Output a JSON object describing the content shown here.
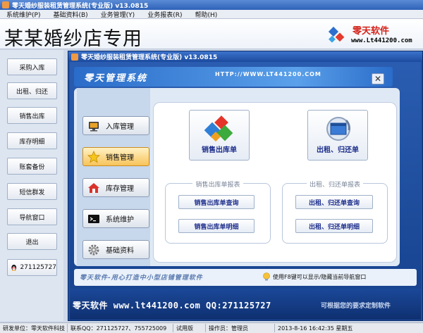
{
  "window": {
    "title": "零天婚纱服装租赁管理系统(专业版)  v13.0815"
  },
  "menu": [
    "系统维护(P)",
    "基础资料(B)",
    "业务管理(Y)",
    "业务报表(R)",
    "帮助(H)"
  ],
  "banner": {
    "shop_title": "某某婚纱店专用",
    "logo_name": "零天软件",
    "logo_url": "www.Lt441200.com"
  },
  "sidebar": {
    "items": [
      "采购入库",
      "出租、归还",
      "销售出库",
      "库存明细",
      "账套备份",
      "短信群发",
      "导航窗口",
      "退出"
    ],
    "qq": "271125727"
  },
  "dialog": {
    "title": "零天婚纱服装租赁管理系统(专业版)  v13.0815",
    "brand": "零天管理系统",
    "url": "HTTP://WWW.LT441200.COM",
    "nav": [
      "入库管理",
      "销售管理",
      "库存管理",
      "系统维护",
      "基础资料"
    ],
    "big_buttons": [
      "销售出库单",
      "出租、归还单"
    ],
    "groups": [
      {
        "title": "销售出库单报表",
        "buttons": [
          "销售出库单查询",
          "销售出库单明细"
        ]
      },
      {
        "title": "出租、归还单报表",
        "buttons": [
          "出租、归还单查询",
          "出租、归还单明细"
        ]
      }
    ],
    "slogan": "零天软件-用心打造中小型店铺管理软件",
    "tip": "使用F8键可以显示/隐藏当前导航窗口",
    "contact": "零天软件  www.lt441200.com  QQ:271125727",
    "marquee": "可根据您的要求定制软件"
  },
  "status": [
    "研发单位：零天软件科技",
    "联系QQ：271125727、755725009",
    "试用版",
    "操作员：管理员",
    "2013-8-16 16:42:35  星期五"
  ],
  "colors": {
    "accent": "#1f4f9f",
    "active": "#f7c35a",
    "logo_red": "#d4231b"
  }
}
